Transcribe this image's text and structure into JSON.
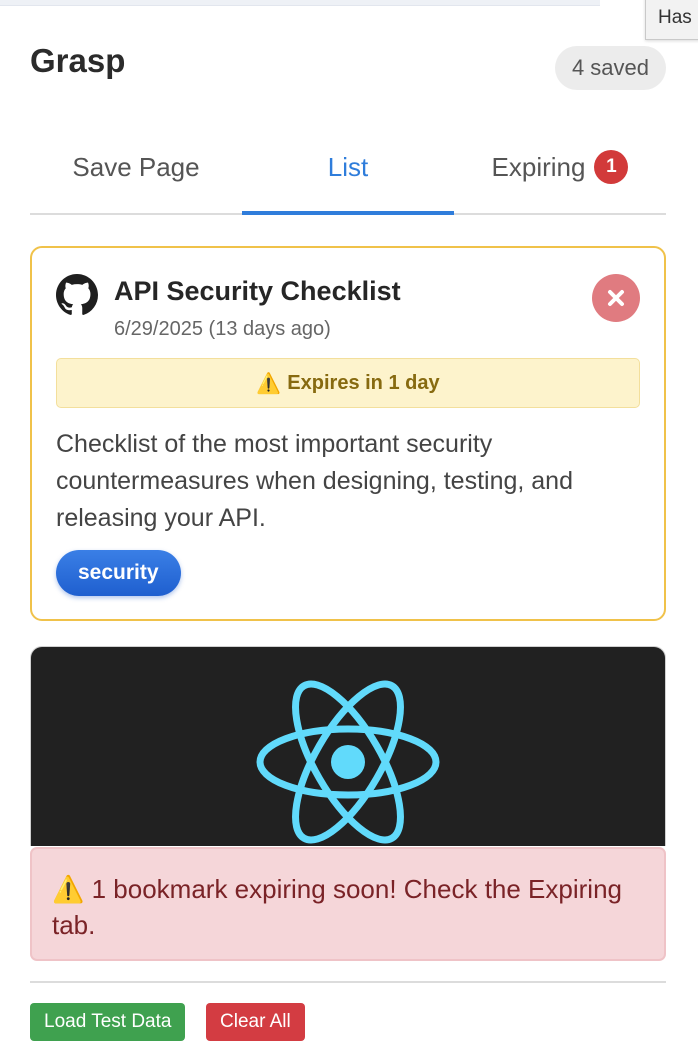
{
  "browser": {
    "tooltip_fragment": "Has"
  },
  "header": {
    "title": "Grasp",
    "saved_count_label": "4 saved"
  },
  "tabs": [
    {
      "label": "Save Page",
      "active": false
    },
    {
      "label": "List",
      "active": true
    },
    {
      "label": "Expiring",
      "active": false,
      "badge": "1"
    }
  ],
  "bookmarks": [
    {
      "icon": "github-icon",
      "title": "API Security Checklist",
      "date": "6/29/2025 (13 days ago)",
      "expiry_notice": "Expires in 1 day",
      "description": "Checklist of the most important security countermeasures when designing, testing, and releasing your API.",
      "tags": [
        "security"
      ]
    },
    {
      "icon": "react-icon"
    }
  ],
  "alert": {
    "text": "1 bookmark expiring soon! Check the Expiring tab."
  },
  "footer": {
    "load_test_label": "Load Test Data",
    "clear_all_label": "Clear All"
  },
  "colors": {
    "accent": "#2f7ddb",
    "warning_border": "#f0c24a",
    "danger": "#d23a3a",
    "success": "#3fa14f"
  }
}
